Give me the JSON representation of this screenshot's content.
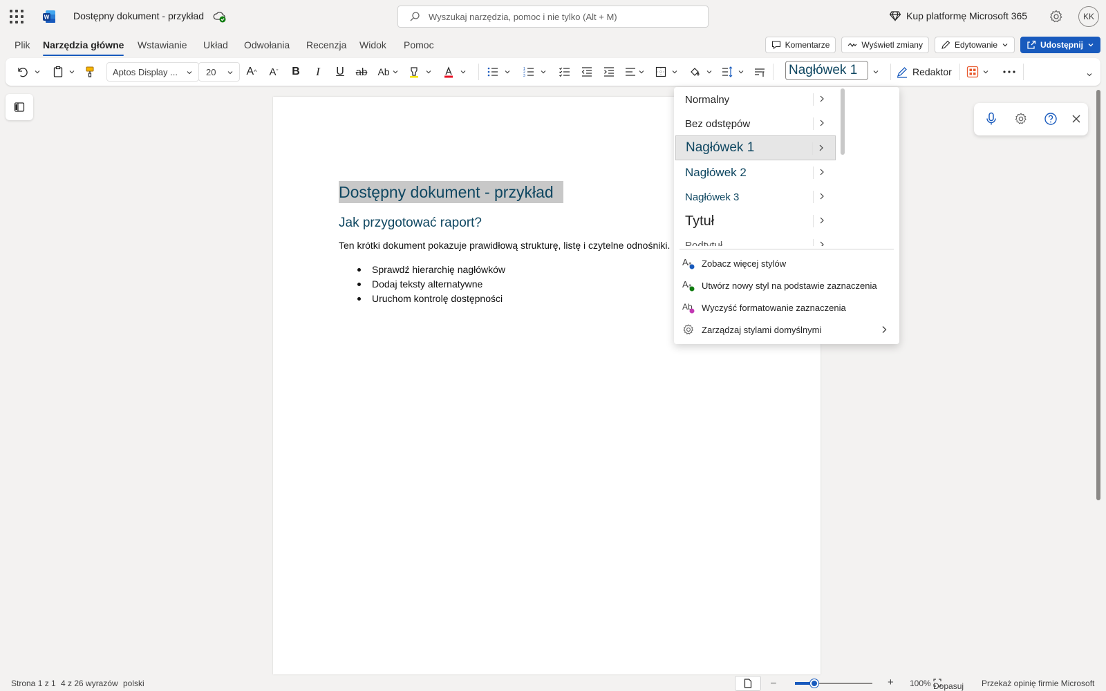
{
  "app": {
    "doc_title": "Dostępny dokument - przykład",
    "search_placeholder": "Wyszukaj narzędzia, pomoc i nie tylko (Alt + M)",
    "buy_label": "Kup platformę Microsoft 365",
    "avatar_initials": "KK",
    "brand_color": "#185abd"
  },
  "tabs": [
    "Plik",
    "Narzędzia główne",
    "Wstawianie",
    "Układ",
    "Odwołania",
    "Recenzja",
    "Widok",
    "Pomoc"
  ],
  "active_tab": "Narzędzia główne",
  "tab_buttons": {
    "comments": "Komentarze",
    "track_changes": "Wyświetl zmiany",
    "editing": "Edytowanie",
    "share": "Udostępnij"
  },
  "ribbon": {
    "font_name": "Aptos Display ...",
    "font_size": "20",
    "current_style": "Nagłówek 1",
    "editor_label": "Redaktor"
  },
  "document": {
    "heading1": "Dostępny dokument - przykład",
    "heading2": "Jak przygotować raport?",
    "paragraph": "Ten krótki dokument pokazuje prawidłową strukturę, listę i czytelne odnośniki.",
    "bullets": [
      "Sprawdź hierarchię nagłówków",
      "Dodaj teksty alternatywne",
      "Uruchom kontrolę dostępności"
    ]
  },
  "styles_dropdown": {
    "styles": [
      {
        "label": "Normalny",
        "color": "#242424",
        "size": "15px",
        "selected": false
      },
      {
        "label": "Bez odstępów",
        "color": "#242424",
        "size": "15px",
        "selected": false
      },
      {
        "label": "Nagłówek 1",
        "color": "#0f4761",
        "size": "19px",
        "selected": true
      },
      {
        "label": "Nagłówek 2",
        "color": "#0f4761",
        "size": "17px",
        "selected": false
      },
      {
        "label": "Nagłówek 3",
        "color": "#0f4761",
        "size": "15px",
        "selected": false
      },
      {
        "label": "Tytuł",
        "color": "#242424",
        "size": "20px",
        "selected": false
      },
      {
        "label": "Podtytuł",
        "color": "#595959",
        "size": "15px",
        "selected": false
      }
    ],
    "actions": [
      {
        "label": "Zobacz więcej stylów",
        "icon": "more-styles-icon"
      },
      {
        "label": "Utwórz nowy styl na podstawie zaznaczenia",
        "icon": "new-style-icon"
      },
      {
        "label": "Wyczyść formatowanie zaznaczenia",
        "icon": "clear-formatting-icon"
      },
      {
        "label": "Zarządzaj stylami domyślnymi",
        "icon": "gear-icon"
      }
    ]
  },
  "status_bar": {
    "page": "Strona 1 z 1",
    "words": "4 z 26 wyrazów",
    "language": "polski",
    "zoom": "100%",
    "zoom_level": 0.25,
    "fit": "Dopasuj",
    "feedback": "Przekaż opinię firmie Microsoft"
  }
}
